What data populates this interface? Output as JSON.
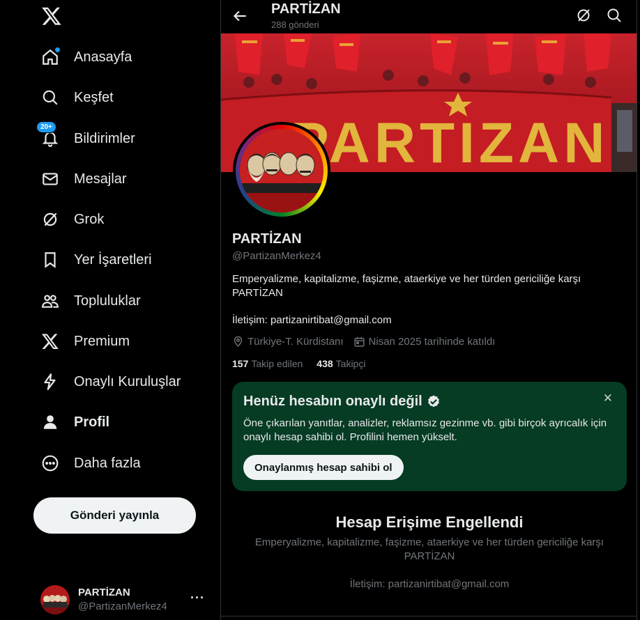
{
  "sidebar": {
    "items": [
      {
        "label": "Anasayfa",
        "icon": "home-icon"
      },
      {
        "label": "Keşfet",
        "icon": "search-icon"
      },
      {
        "label": "Bildirimler",
        "icon": "bell-icon",
        "badge": "20+"
      },
      {
        "label": "Mesajlar",
        "icon": "mail-icon"
      },
      {
        "label": "Grok",
        "icon": "grok-icon"
      },
      {
        "label": "Yer İşaretleri",
        "icon": "bookmark-icon"
      },
      {
        "label": "Topluluklar",
        "icon": "communities-icon"
      },
      {
        "label": "Premium",
        "icon": "x-premium-icon"
      },
      {
        "label": "Onaylı Kuruluşlar",
        "icon": "lightning-icon"
      },
      {
        "label": "Profil",
        "icon": "person-icon"
      },
      {
        "label": "Daha fazla",
        "icon": "more-circle-icon"
      }
    ],
    "post_button": "Gönderi yayınla",
    "account": {
      "name": "PARTİZAN",
      "handle": "@PartizanMerkez4",
      "more": "···"
    }
  },
  "header": {
    "title": "PARTİZAN",
    "subtitle": "288 gönderi"
  },
  "banner": {
    "text": "PARTIZAN"
  },
  "profile": {
    "name": "PARTİZAN",
    "handle": "@PartizanMerkez4",
    "bio": "Emperyalizme, kapitalizme, faşizme, ataerkiye ve her türden gericiliğe karşı PARTİZAN",
    "contact": "İletişim: partizanirtibat@gmail.com",
    "location": "Türkiye-T. Kürdistanı",
    "joined": "Nisan 2025 tarihinde katıldı",
    "following_count": "157",
    "following_label": "Takip edilen",
    "followers_count": "438",
    "followers_label": "Takipçi"
  },
  "verify_card": {
    "title": "Henüz hesabın onaylı değil",
    "text": "Öne çıkarılan yanıtlar, analizler, reklamsız gezinme vb. gibi birçok ayrıcalık için onaylı hesap sahibi ol. Profilini hemen yükselt.",
    "button": "Onaylanmış hesap sahibi ol",
    "close": "✕",
    "bg_color": "#063b24"
  },
  "blocked": {
    "title": "Hesap Erişime Engellendi",
    "bio": "Emperyalizme, kapitalizme, faşizme, ataerkiye ve her türden gericiliğe karşı PARTİZAN",
    "contact": "İletişim: partizanirtibat@gmail.com"
  },
  "colors": {
    "accent": "#1d9bf0",
    "muted": "#71767b",
    "text": "#e7e9ea"
  }
}
